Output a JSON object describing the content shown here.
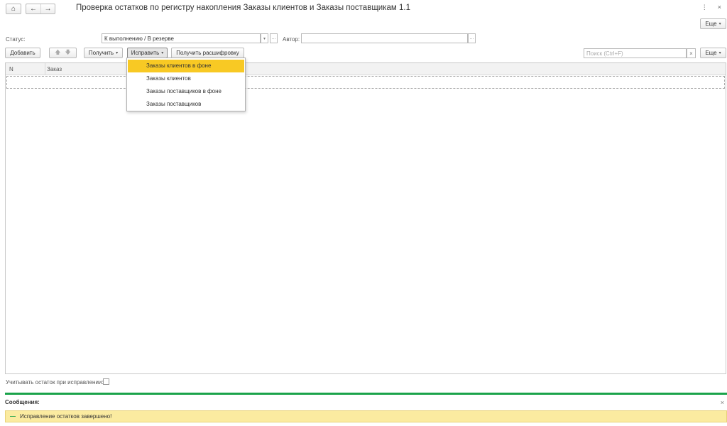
{
  "header": {
    "home_icon": "⌂",
    "back_icon": "←",
    "forward_icon": "→",
    "title": "Проверка остатков по регистру накопления Заказы клиентов и Заказы поставщикам 1.1",
    "more_icon": "⋮",
    "close_icon": "×",
    "more_button": "Еще"
  },
  "filters": {
    "status_label": "Статус:",
    "status_value": "К выполнению / В резерве",
    "author_label": "Автор:",
    "author_value": ""
  },
  "toolbar": {
    "add": "Добавить",
    "up_icon": "🡅",
    "down_icon": "🡇",
    "get": "Получить",
    "fix": "Исправить",
    "get_details": "Получить расшифровку",
    "search_placeholder": "Поиск (Ctrl+F)",
    "clear_icon": "×",
    "more": "Еще"
  },
  "table": {
    "columns": [
      "N",
      "Заказ"
    ]
  },
  "fix_menu": {
    "items": [
      {
        "label": "Заказы клиентов в фоне",
        "active": true
      },
      {
        "label": "Заказы клиентов",
        "active": false
      },
      {
        "label": "Заказы поставщиков в фоне",
        "active": false
      },
      {
        "label": "Заказы поставщиков",
        "active": false
      }
    ]
  },
  "options": {
    "consider_balance_label": "Учитывать остаток при исправлении:"
  },
  "messages": {
    "title": "Сообщения:",
    "text": "Исправление остатков завершено!"
  },
  "colors": {
    "accent_yellow": "#f8c924",
    "message_bg": "#fbeba0",
    "separator_green": "#1aa34a"
  }
}
